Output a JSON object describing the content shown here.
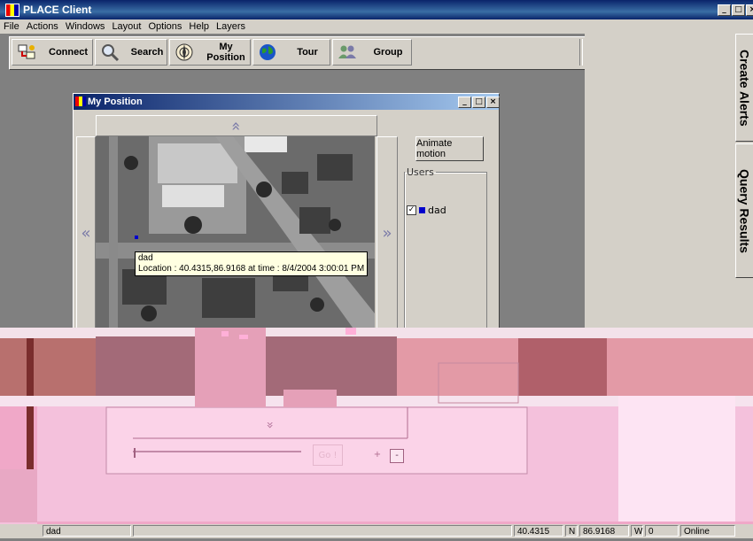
{
  "window": {
    "title": "PLACE Client",
    "min": "_",
    "max": "□",
    "close": "×"
  },
  "menu": [
    "File",
    "Actions",
    "Windows",
    "Layout",
    "Options",
    "Help",
    "Layers"
  ],
  "toolbar": {
    "connect": "Connect",
    "search": "Search",
    "my_position": "My Position",
    "tour": "Tour",
    "group": "Group"
  },
  "right_tabs": {
    "create_alerts": "Create Alerts",
    "query_results": "Query Results"
  },
  "my_position": {
    "title": "My Position",
    "up": "«",
    "down": "»",
    "left": "«",
    "right": "»",
    "animate_motion": "Animate motion",
    "users_legend": "Users",
    "users": [
      {
        "name": "dad",
        "checked": true,
        "color": "#0000cc"
      }
    ],
    "tooltip_name": "dad",
    "tooltip_location": "Location : 40.4315,86.9168 at time : 8/4/2004 3:00:01 PM",
    "go_button": "Go !",
    "zoom_plus": "+",
    "zoom_minus": "-",
    "slider_value": 0
  },
  "status": {
    "user": "dad",
    "lat": "40.4315",
    "lat_dir": "N",
    "lon": "86.9168",
    "lon_dir": "W",
    "extra": "0",
    "connection": "Online"
  },
  "colors": {
    "titlebar": "#0a246a",
    "face": "#d4d0c8",
    "desktop": "#808080"
  }
}
